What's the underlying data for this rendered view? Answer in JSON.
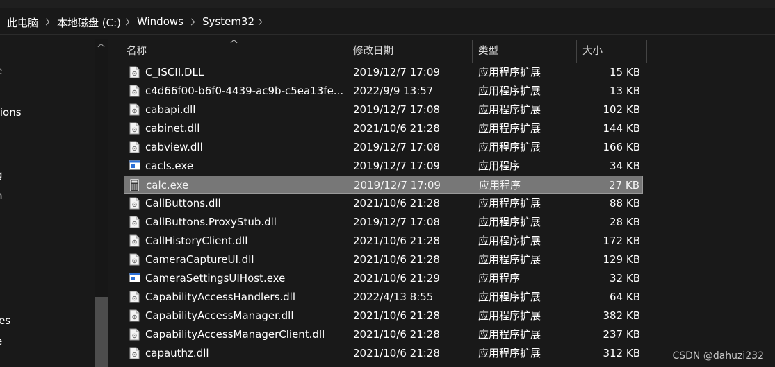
{
  "breadcrumb": [
    "此电脑",
    "本地磁盘 (C:)",
    "Windows",
    "System32"
  ],
  "nav": {
    "fragments": [
      "e",
      "tions",
      "g",
      "n",
      "les",
      "e"
    ]
  },
  "columns": {
    "name": "名称",
    "date": "修改日期",
    "type": "类型",
    "size": "大小"
  },
  "files": [
    {
      "name": "C_ISCII.DLL",
      "date": "2019/12/7 17:09",
      "type": "应用程序扩展",
      "size": "15 KB",
      "icon": "dll-file-icon"
    },
    {
      "name": "c4d66f00-b6f0-4439-ac9b-c5ea13fe...",
      "date": "2022/9/9 13:57",
      "type": "应用程序扩展",
      "size": "13 KB",
      "icon": "dll-file-icon"
    },
    {
      "name": "cabapi.dll",
      "date": "2019/12/7 17:08",
      "type": "应用程序扩展",
      "size": "102 KB",
      "icon": "dll-file-icon"
    },
    {
      "name": "cabinet.dll",
      "date": "2021/10/6 21:28",
      "type": "应用程序扩展",
      "size": "144 KB",
      "icon": "dll-file-icon"
    },
    {
      "name": "cabview.dll",
      "date": "2019/12/7 17:08",
      "type": "应用程序扩展",
      "size": "166 KB",
      "icon": "dll-file-icon"
    },
    {
      "name": "cacls.exe",
      "date": "2019/12/7 17:09",
      "type": "应用程序",
      "size": "34 KB",
      "icon": "exe-file-icon"
    },
    {
      "name": "calc.exe",
      "date": "2019/12/7 17:09",
      "type": "应用程序",
      "size": "27 KB",
      "icon": "calculator-icon",
      "selected": true
    },
    {
      "name": "CallButtons.dll",
      "date": "2021/10/6 21:28",
      "type": "应用程序扩展",
      "size": "88 KB",
      "icon": "dll-file-icon"
    },
    {
      "name": "CallButtons.ProxyStub.dll",
      "date": "2019/12/7 17:08",
      "type": "应用程序扩展",
      "size": "28 KB",
      "icon": "dll-file-icon"
    },
    {
      "name": "CallHistoryClient.dll",
      "date": "2021/10/6 21:28",
      "type": "应用程序扩展",
      "size": "172 KB",
      "icon": "dll-file-icon"
    },
    {
      "name": "CameraCaptureUI.dll",
      "date": "2021/10/6 21:28",
      "type": "应用程序扩展",
      "size": "129 KB",
      "icon": "dll-file-icon"
    },
    {
      "name": "CameraSettingsUIHost.exe",
      "date": "2021/10/6 21:29",
      "type": "应用程序",
      "size": "32 KB",
      "icon": "exe-file-icon"
    },
    {
      "name": "CapabilityAccessHandlers.dll",
      "date": "2022/4/13 8:55",
      "type": "应用程序扩展",
      "size": "64 KB",
      "icon": "dll-file-icon"
    },
    {
      "name": "CapabilityAccessManager.dll",
      "date": "2021/10/6 21:28",
      "type": "应用程序扩展",
      "size": "382 KB",
      "icon": "dll-file-icon"
    },
    {
      "name": "CapabilityAccessManagerClient.dll",
      "date": "2021/10/6 21:28",
      "type": "应用程序扩展",
      "size": "237 KB",
      "icon": "dll-file-icon"
    },
    {
      "name": "capauthz.dll",
      "date": "2021/10/6 21:28",
      "type": "应用程序扩展",
      "size": "312 KB",
      "icon": "dll-file-icon"
    }
  ],
  "watermark": "CSDN @dahuzi232",
  "colors": {
    "background": "#191919",
    "selected_row": "#777777",
    "text": "#ffffff"
  }
}
